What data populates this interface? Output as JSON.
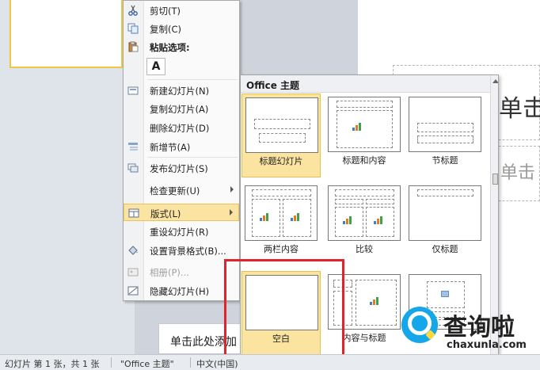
{
  "menu": {
    "items": [
      {
        "id": "cut",
        "label": "剪切(T)",
        "icon": "scissors-icon"
      },
      {
        "id": "copy",
        "label": "复制(C)",
        "icon": "copy-icon"
      },
      {
        "id": "paste_options",
        "label": "粘贴选项:",
        "icon": "clipboard-icon"
      },
      {
        "id": "new_slide",
        "label": "新建幻灯片(N)",
        "icon": "new-slide-icon"
      },
      {
        "id": "duplicate_slide",
        "label": "复制幻灯片(A)",
        "icon": ""
      },
      {
        "id": "delete_slide",
        "label": "删除幻灯片(D)",
        "icon": ""
      },
      {
        "id": "add_section",
        "label": "新增节(A)",
        "icon": "section-icon"
      },
      {
        "id": "publish_slides",
        "label": "发布幻灯片(S)",
        "icon": "publish-icon"
      },
      {
        "id": "check_updates",
        "label": "检查更新(U)",
        "icon": ""
      },
      {
        "id": "layout",
        "label": "版式(L)",
        "icon": "layout-icon"
      },
      {
        "id": "reset_slide",
        "label": "重设幻灯片(R)",
        "icon": ""
      },
      {
        "id": "format_background",
        "label": "设置背景格式(B)...",
        "icon": "paint-bucket-icon"
      },
      {
        "id": "photo_album",
        "label": "相册(P)...",
        "icon": "photo-album-icon"
      },
      {
        "id": "hide_slide",
        "label": "隐藏幻灯片(H)",
        "icon": "hide-slide-icon"
      }
    ],
    "paste_keep_text_label": "A"
  },
  "gallery": {
    "title": "Office 主题",
    "layouts": [
      {
        "label": "标题幻灯片"
      },
      {
        "label": "标题和内容"
      },
      {
        "label": "节标题"
      },
      {
        "label": "两栏内容"
      },
      {
        "label": "比较"
      },
      {
        "label": "仅标题"
      },
      {
        "label": "空白"
      },
      {
        "label": "内容与标题"
      },
      {
        "label": ""
      }
    ]
  },
  "slide": {
    "title_placeholder": "单击",
    "subtitle_placeholder": "单击",
    "notes_placeholder": "单击此处添加"
  },
  "statusbar": {
    "slide_count": "幻灯片 第 1 张，共 1 张",
    "theme": "\"Office 主题\"",
    "language": "中文(中国)"
  },
  "watermark": {
    "text": "查询啦",
    "url": "chaxunla.com"
  },
  "colors": {
    "selected_fill": "#fbe3a0",
    "selected_border": "#e8bf52",
    "highlight_box": "#e0242a",
    "watermark_blue": "#15a7ea"
  }
}
